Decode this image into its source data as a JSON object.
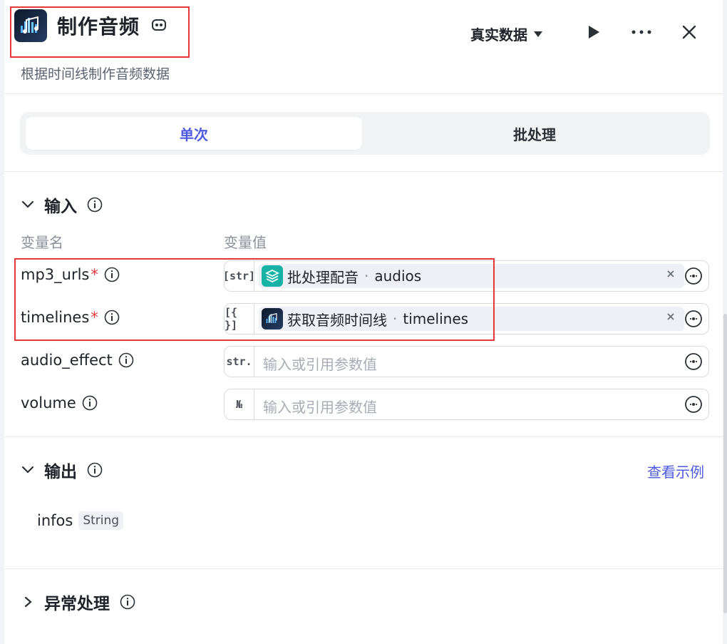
{
  "header": {
    "title": "制作音频",
    "subtitle": "根据时间线制作音频数据",
    "data_mode": "真实数据"
  },
  "tabs": {
    "single": "单次",
    "batch": "批处理"
  },
  "input": {
    "section_title": "输入",
    "col_name": "变量名",
    "col_value": "变量值",
    "rows": [
      {
        "name": "mp3_urls",
        "required": "*",
        "type": "[str]",
        "ref_source": "批处理配音",
        "ref_sep": "·",
        "ref_field": "audios"
      },
      {
        "name": "timelines",
        "required": "*",
        "type": "[{ }]",
        "ref_source": "获取音频时间线",
        "ref_sep": "·",
        "ref_field": "timelines"
      },
      {
        "name": "audio_effect",
        "type": "str.",
        "placeholder": "输入或引用参数值"
      },
      {
        "name": "volume",
        "type": "№",
        "placeholder": "输入或引用参数值"
      }
    ]
  },
  "output": {
    "section_title": "输出",
    "view_example": "查看示例",
    "var_name": "infos",
    "var_type": "String"
  },
  "exception": {
    "section_title": "异常处理"
  },
  "colors": {
    "accent": "#4e5ae0",
    "required": "#e5383b",
    "highlight_box": "#e5383b"
  }
}
